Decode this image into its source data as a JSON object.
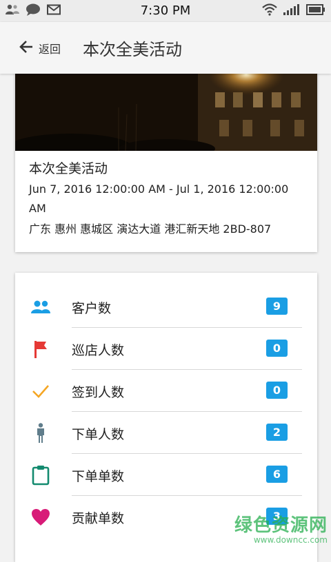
{
  "status_bar": {
    "time": "7:30 PM",
    "icons": [
      "contacts-icon",
      "chat-bubble-icon",
      "mail-icon",
      "wifi-icon",
      "signal-icon",
      "battery-icon"
    ]
  },
  "appbar": {
    "back_label": "返回",
    "title": "本次全美活动"
  },
  "event": {
    "title": "本次全美活动",
    "time": "Jun 7, 2016 12:00:00 AM - Jul 1, 2016 12:00:00 AM",
    "address": "广东 惠州 惠城区 演达大道 港汇新天地 2BD-807"
  },
  "stats": [
    {
      "label": "客户数",
      "count": "9",
      "icon": "people-icon",
      "color": "#1a9ee4"
    },
    {
      "label": "巡店人数",
      "count": "0",
      "icon": "flag-icon",
      "color": "#e53935"
    },
    {
      "label": "签到人数",
      "count": "0",
      "icon": "check-icon",
      "color": "#f5a623"
    },
    {
      "label": "下单人数",
      "count": "2",
      "icon": "person-icon",
      "color": "#607d8b"
    },
    {
      "label": "下单单数",
      "count": "6",
      "icon": "clipboard-icon",
      "color": "#138a6f"
    },
    {
      "label": "贡献单数",
      "count": "3",
      "icon": "heart-icon",
      "color": "#d81b78"
    }
  ],
  "watermark": {
    "brand": "绿色资源网",
    "url": "www.downcc.com"
  },
  "colors": {
    "badge": "#1a9ee4",
    "appbar_bg": "#f5f5f5",
    "page_bg": "#f2f2f2"
  }
}
